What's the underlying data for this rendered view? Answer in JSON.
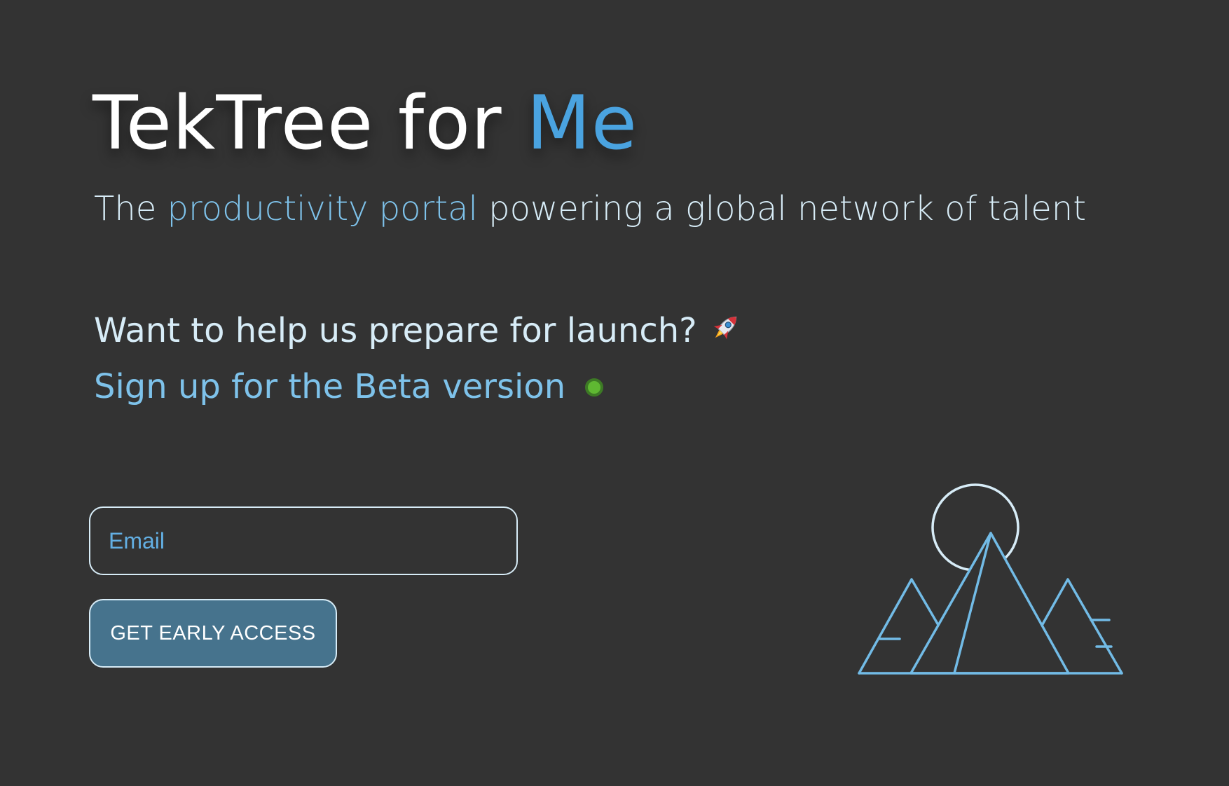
{
  "hero": {
    "title_main": "TekTree for ",
    "title_accent": "Me"
  },
  "subtitle": {
    "prefix": "The ",
    "accent": "productivity portal",
    "suffix": " powering a global network of talent"
  },
  "prompt": {
    "text": "Want to help us prepare for launch?",
    "icon": "rocket-icon"
  },
  "beta": {
    "text": "Sign up for the Beta version",
    "status_icon": "green-dot-icon"
  },
  "form": {
    "email_placeholder": "Email",
    "email_value": "",
    "submit_label": "GET EARLY ACCESS"
  },
  "illustration": {
    "icon": "mountain-sun-icon"
  },
  "colors": {
    "background": "#333333",
    "accent": "#4aa3e0",
    "light_accent": "#7ec2ea",
    "text": "#d7ecf7",
    "button": "#46738d",
    "status_green": "#5fb832"
  }
}
